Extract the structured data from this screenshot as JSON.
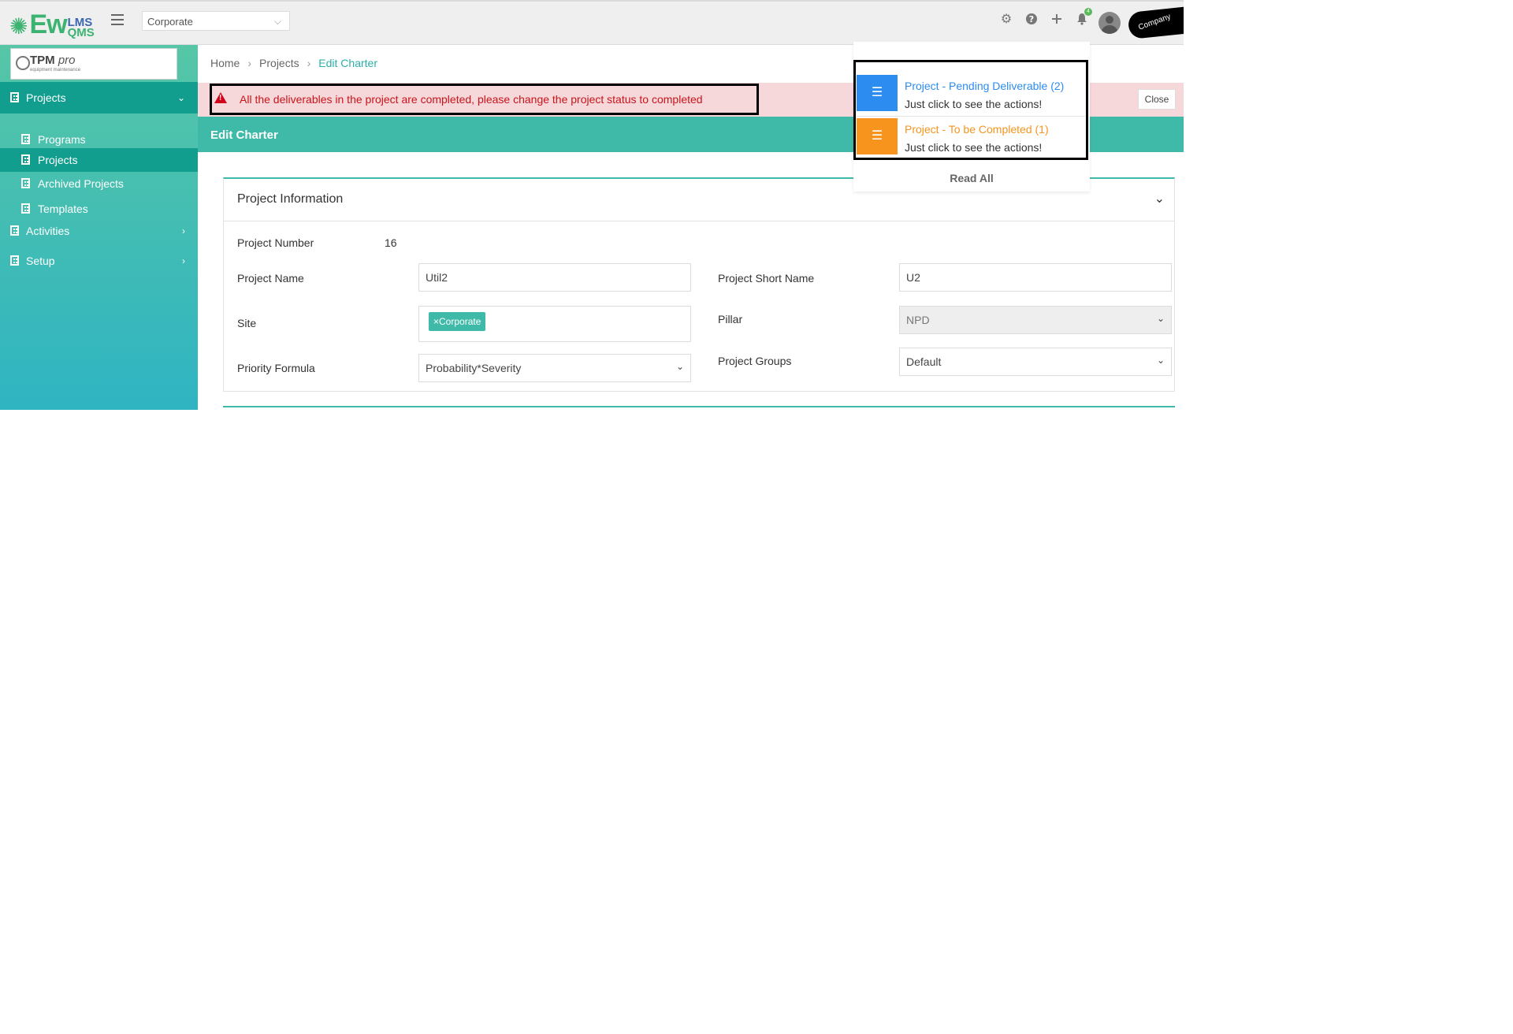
{
  "app": {
    "logo_main": "Ew",
    "logo_top": "LMS",
    "logo_bottom": "QMS",
    "company_select": "Corporate",
    "company_logo_text": "Company"
  },
  "sidebar": {
    "brand_title": "TPM",
    "brand_italic": "pro",
    "brand_subtitle": "equipment maintenance",
    "items": [
      {
        "label": "Projects"
      },
      {
        "label": "Programs"
      },
      {
        "label": "Projects"
      },
      {
        "label": "Archived Projects"
      },
      {
        "label": "Templates"
      },
      {
        "label": "Activities"
      },
      {
        "label": "Setup"
      }
    ]
  },
  "breadcrumb": [
    "Home",
    "Projects",
    "Edit Charter"
  ],
  "alert": {
    "message": "All the deliverables in the project are completed, please change the project status to completed",
    "close_label": "Close"
  },
  "page_title": "Edit Charter",
  "panel": {
    "title": "Project Information",
    "fields": {
      "project_number_label": "Project Number",
      "project_number_value": "16",
      "project_name_label": "Project Name",
      "project_name_value": "Util2",
      "project_short_name_label": "Project Short Name",
      "project_short_name_value": "U2",
      "site_label": "Site",
      "site_tag": "×Corporate",
      "pillar_label": "Pillar",
      "pillar_value": "NPD",
      "priority_formula_label": "Priority Formula",
      "priority_formula_value": "Probability*Severity",
      "project_groups_label": "Project Groups",
      "project_groups_value": "Default"
    }
  },
  "notifications": {
    "badge": "4",
    "items": [
      {
        "title": "Project - Pending Deliverable (2)",
        "subtitle": "Just click to see the actions!",
        "color": "#2d8cf0"
      },
      {
        "title": "Project - To be Completed (1)",
        "subtitle": "Just click to see the actions!",
        "color": "#f7941d"
      }
    ],
    "read_all": "Read All"
  },
  "colors": {
    "accent": "#3fbaa9",
    "sidebar_active": "#129e8e",
    "alert_text": "#c9141a",
    "alert_bg": "#f6d7da"
  }
}
